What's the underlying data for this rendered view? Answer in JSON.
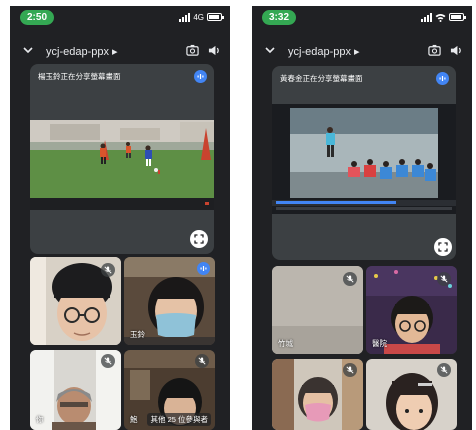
{
  "left": {
    "status": {
      "time": "2:50",
      "network": "4G"
    },
    "meeting_code": "ycj-edap-ppx",
    "presenter_label": "楊玉鈴正在分享螢幕畫面",
    "tiles": [
      {
        "name": ""
      },
      {
        "name": "玉鈴"
      },
      {
        "name": "你"
      },
      {
        "name": "鮑"
      }
    ],
    "more_participants": "其他 25 位參與者"
  },
  "right": {
    "status": {
      "time": "3:32"
    },
    "meeting_code": "ycj-edap-ppx",
    "presenter_label": "黃春金正在分享螢幕畫面",
    "tiles": [
      {
        "name": "竹城"
      },
      {
        "name": "醫院"
      },
      {
        "name": ""
      },
      {
        "name": ""
      }
    ]
  },
  "colors": {
    "accent_green": "#34a853",
    "audio_blue": "#4285f4",
    "background": "#202124",
    "tile": "#3c4043"
  },
  "icons": [
    "chevron-down-icon",
    "camera-switch-icon",
    "speaker-icon",
    "audio-level-icon",
    "mic-off-icon",
    "fullscreen-icon",
    "wifi-icon",
    "battery-icon",
    "signal-icon"
  ]
}
